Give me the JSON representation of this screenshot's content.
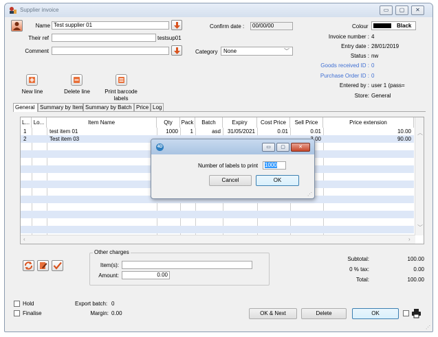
{
  "window": {
    "title": "Supplier invoice",
    "controls": {
      "minimize": "▭",
      "maximize": "▢",
      "close": "✕"
    }
  },
  "header": {
    "name_label": "Name",
    "name_value": "Test supplier 01",
    "their_ref_label": "Their ref",
    "their_ref_value": "",
    "supplier_code": "testsup01",
    "comment_label": "Comment",
    "comment_value": "",
    "confirm_date_label": "Confirm date :",
    "confirm_date_value": "00/00/00",
    "category_label": "Category",
    "category_value": "None",
    "colour_label": "Colour",
    "colour_value": "Black"
  },
  "info": {
    "invoice_number_label": "Invoice number :",
    "invoice_number_value": "4",
    "entry_date_label": "Entry date :",
    "entry_date_value": "28/01/2019",
    "status_label": "Status :",
    "status_value": "nw",
    "goods_received_label": "Goods received ID :",
    "goods_received_value": "0",
    "purchase_order_label": "Purchase Order ID :",
    "purchase_order_value": "0",
    "entered_by_label": "Entered by :",
    "entered_by_value": "user 1 (pass=",
    "store_label": "Store:",
    "store_value": "General"
  },
  "toolbar": {
    "new_line": "New line",
    "delete_line": "Delete line",
    "print_barcode_line1": "Print barcode",
    "print_barcode_line2": "labels"
  },
  "tabs": [
    "General",
    "Summary by Item",
    "Summary by Batch",
    "Price",
    "Log"
  ],
  "grid": {
    "columns": [
      "L...",
      "Lo...",
      "Item Name",
      "Qty",
      "Pack",
      "Batch",
      "Expiry",
      "Cost Price",
      "Sell Price",
      "Price extension"
    ],
    "rows": [
      {
        "line": "1",
        "loc": "",
        "item": "test item 01",
        "qty": "1000",
        "pack": "1",
        "batch": "asd",
        "expiry": "31/05/2021",
        "cost": "0.01",
        "sell": "0.01",
        "ext": "10.00"
      },
      {
        "line": "2",
        "loc": "",
        "item": "Test item 03",
        "qty": "",
        "pack": "",
        "batch": "",
        "expiry": "",
        "cost": "",
        "sell": "3.00",
        "ext": "90.00"
      }
    ]
  },
  "other_charges": {
    "legend": "Other charges",
    "items_label": "Item(s):",
    "items_value": "",
    "amount_label": "Amount:",
    "amount_value": "0.00"
  },
  "totals": {
    "subtotal_label": "Subtotal:",
    "subtotal_value": "100.00",
    "tax_label": "0 % tax:",
    "tax_value": "0.00",
    "total_label": "Total:",
    "total_value": "100.00"
  },
  "footer": {
    "hold_label": "Hold",
    "finalise_label": "Finalise",
    "export_batch_label": "Export batch:",
    "export_batch_value": "0",
    "margin_label": "Margin:",
    "margin_value": "0.00",
    "ok_next": "OK & Next",
    "delete": "Delete",
    "ok": "OK"
  },
  "dialog": {
    "icon_text": "4D",
    "prompt": "Number of labels to print",
    "value": "1000",
    "cancel": "Cancel",
    "ok": "OK"
  }
}
